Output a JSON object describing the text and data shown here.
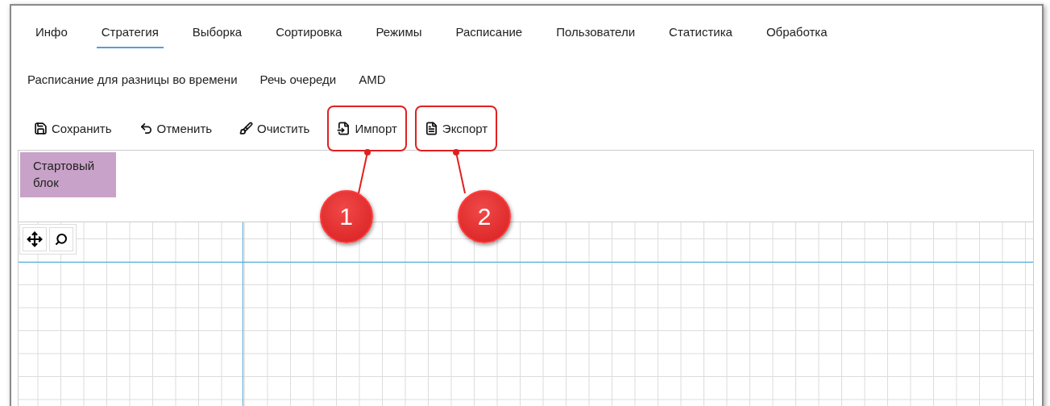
{
  "tabs": [
    {
      "label": "Инфо",
      "selected": false
    },
    {
      "label": "Стратегия",
      "selected": true
    },
    {
      "label": "Выборка",
      "selected": false
    },
    {
      "label": "Сортировка",
      "selected": false
    },
    {
      "label": "Режимы",
      "selected": false
    },
    {
      "label": "Расписание",
      "selected": false
    },
    {
      "label": "Пользователи",
      "selected": false
    },
    {
      "label": "Статистика",
      "selected": false
    },
    {
      "label": "Обработка",
      "selected": false
    }
  ],
  "subtabs": [
    "Расписание для разницы во времени",
    "Речь очереди",
    "AMD"
  ],
  "toolbar": [
    {
      "kind": "save",
      "label": "Сохранить",
      "highlighted": false
    },
    {
      "kind": "undo",
      "label": "Отменить",
      "highlighted": false
    },
    {
      "kind": "clear",
      "label": "Очистить",
      "highlighted": false
    },
    {
      "kind": "import",
      "label": "Импорт",
      "highlighted": true,
      "callout": "1"
    },
    {
      "kind": "export",
      "label": "Экспорт",
      "highlighted": true,
      "callout": "2"
    }
  ],
  "blocks": [
    {
      "label": "Стартовый блок"
    }
  ]
}
